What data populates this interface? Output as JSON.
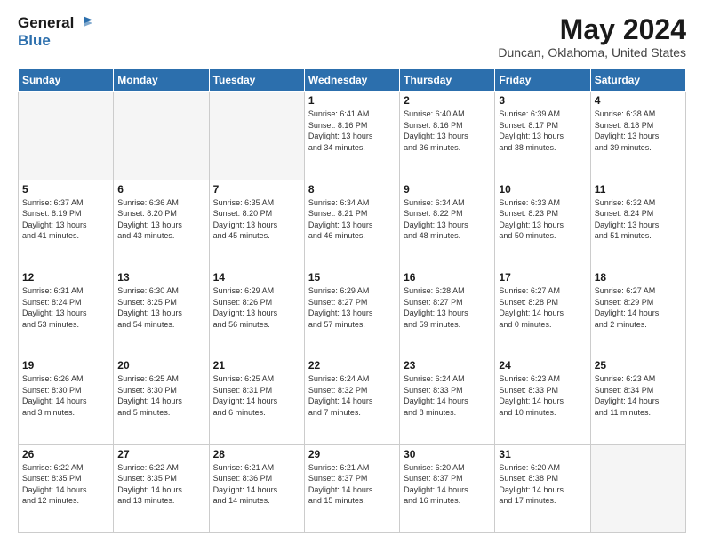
{
  "header": {
    "logo_line1": "General",
    "logo_line2": "Blue",
    "title": "May 2024",
    "location": "Duncan, Oklahoma, United States"
  },
  "weekdays": [
    "Sunday",
    "Monday",
    "Tuesday",
    "Wednesday",
    "Thursday",
    "Friday",
    "Saturday"
  ],
  "weeks": [
    [
      {
        "day": "",
        "info": ""
      },
      {
        "day": "",
        "info": ""
      },
      {
        "day": "",
        "info": ""
      },
      {
        "day": "1",
        "info": "Sunrise: 6:41 AM\nSunset: 8:16 PM\nDaylight: 13 hours\nand 34 minutes."
      },
      {
        "day": "2",
        "info": "Sunrise: 6:40 AM\nSunset: 8:16 PM\nDaylight: 13 hours\nand 36 minutes."
      },
      {
        "day": "3",
        "info": "Sunrise: 6:39 AM\nSunset: 8:17 PM\nDaylight: 13 hours\nand 38 minutes."
      },
      {
        "day": "4",
        "info": "Sunrise: 6:38 AM\nSunset: 8:18 PM\nDaylight: 13 hours\nand 39 minutes."
      }
    ],
    [
      {
        "day": "5",
        "info": "Sunrise: 6:37 AM\nSunset: 8:19 PM\nDaylight: 13 hours\nand 41 minutes."
      },
      {
        "day": "6",
        "info": "Sunrise: 6:36 AM\nSunset: 8:20 PM\nDaylight: 13 hours\nand 43 minutes."
      },
      {
        "day": "7",
        "info": "Sunrise: 6:35 AM\nSunset: 8:20 PM\nDaylight: 13 hours\nand 45 minutes."
      },
      {
        "day": "8",
        "info": "Sunrise: 6:34 AM\nSunset: 8:21 PM\nDaylight: 13 hours\nand 46 minutes."
      },
      {
        "day": "9",
        "info": "Sunrise: 6:34 AM\nSunset: 8:22 PM\nDaylight: 13 hours\nand 48 minutes."
      },
      {
        "day": "10",
        "info": "Sunrise: 6:33 AM\nSunset: 8:23 PM\nDaylight: 13 hours\nand 50 minutes."
      },
      {
        "day": "11",
        "info": "Sunrise: 6:32 AM\nSunset: 8:24 PM\nDaylight: 13 hours\nand 51 minutes."
      }
    ],
    [
      {
        "day": "12",
        "info": "Sunrise: 6:31 AM\nSunset: 8:24 PM\nDaylight: 13 hours\nand 53 minutes."
      },
      {
        "day": "13",
        "info": "Sunrise: 6:30 AM\nSunset: 8:25 PM\nDaylight: 13 hours\nand 54 minutes."
      },
      {
        "day": "14",
        "info": "Sunrise: 6:29 AM\nSunset: 8:26 PM\nDaylight: 13 hours\nand 56 minutes."
      },
      {
        "day": "15",
        "info": "Sunrise: 6:29 AM\nSunset: 8:27 PM\nDaylight: 13 hours\nand 57 minutes."
      },
      {
        "day": "16",
        "info": "Sunrise: 6:28 AM\nSunset: 8:27 PM\nDaylight: 13 hours\nand 59 minutes."
      },
      {
        "day": "17",
        "info": "Sunrise: 6:27 AM\nSunset: 8:28 PM\nDaylight: 14 hours\nand 0 minutes."
      },
      {
        "day": "18",
        "info": "Sunrise: 6:27 AM\nSunset: 8:29 PM\nDaylight: 14 hours\nand 2 minutes."
      }
    ],
    [
      {
        "day": "19",
        "info": "Sunrise: 6:26 AM\nSunset: 8:30 PM\nDaylight: 14 hours\nand 3 minutes."
      },
      {
        "day": "20",
        "info": "Sunrise: 6:25 AM\nSunset: 8:30 PM\nDaylight: 14 hours\nand 5 minutes."
      },
      {
        "day": "21",
        "info": "Sunrise: 6:25 AM\nSunset: 8:31 PM\nDaylight: 14 hours\nand 6 minutes."
      },
      {
        "day": "22",
        "info": "Sunrise: 6:24 AM\nSunset: 8:32 PM\nDaylight: 14 hours\nand 7 minutes."
      },
      {
        "day": "23",
        "info": "Sunrise: 6:24 AM\nSunset: 8:33 PM\nDaylight: 14 hours\nand 8 minutes."
      },
      {
        "day": "24",
        "info": "Sunrise: 6:23 AM\nSunset: 8:33 PM\nDaylight: 14 hours\nand 10 minutes."
      },
      {
        "day": "25",
        "info": "Sunrise: 6:23 AM\nSunset: 8:34 PM\nDaylight: 14 hours\nand 11 minutes."
      }
    ],
    [
      {
        "day": "26",
        "info": "Sunrise: 6:22 AM\nSunset: 8:35 PM\nDaylight: 14 hours\nand 12 minutes."
      },
      {
        "day": "27",
        "info": "Sunrise: 6:22 AM\nSunset: 8:35 PM\nDaylight: 14 hours\nand 13 minutes."
      },
      {
        "day": "28",
        "info": "Sunrise: 6:21 AM\nSunset: 8:36 PM\nDaylight: 14 hours\nand 14 minutes."
      },
      {
        "day": "29",
        "info": "Sunrise: 6:21 AM\nSunset: 8:37 PM\nDaylight: 14 hours\nand 15 minutes."
      },
      {
        "day": "30",
        "info": "Sunrise: 6:20 AM\nSunset: 8:37 PM\nDaylight: 14 hours\nand 16 minutes."
      },
      {
        "day": "31",
        "info": "Sunrise: 6:20 AM\nSunset: 8:38 PM\nDaylight: 14 hours\nand 17 minutes."
      },
      {
        "day": "",
        "info": ""
      }
    ]
  ]
}
